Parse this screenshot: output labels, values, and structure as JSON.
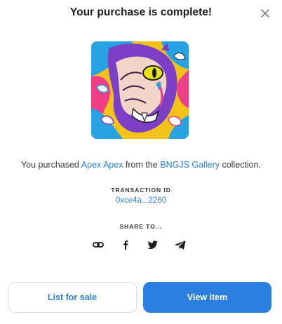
{
  "modal": {
    "title": "Your purchase is complete!",
    "close_icon": "close-icon"
  },
  "artwork": {
    "icon": "nft-artwork-image"
  },
  "purchase": {
    "prefix": "You purchased ",
    "item_name": "Apex Apex",
    "middle": " from the ",
    "collection_name": "BNGJS Gallery",
    "suffix": " collection."
  },
  "transaction": {
    "label": "TRANSACTION ID",
    "id": "0xce4a...2260"
  },
  "share": {
    "label": "SHARE TO...",
    "icons": [
      "link-icon",
      "facebook-icon",
      "twitter-icon",
      "telegram-icon"
    ]
  },
  "actions": {
    "list_for_sale": "List for sale",
    "view_item": "View item"
  },
  "colors": {
    "accent": "#2a7fe0",
    "text": "#1c1c1c"
  }
}
